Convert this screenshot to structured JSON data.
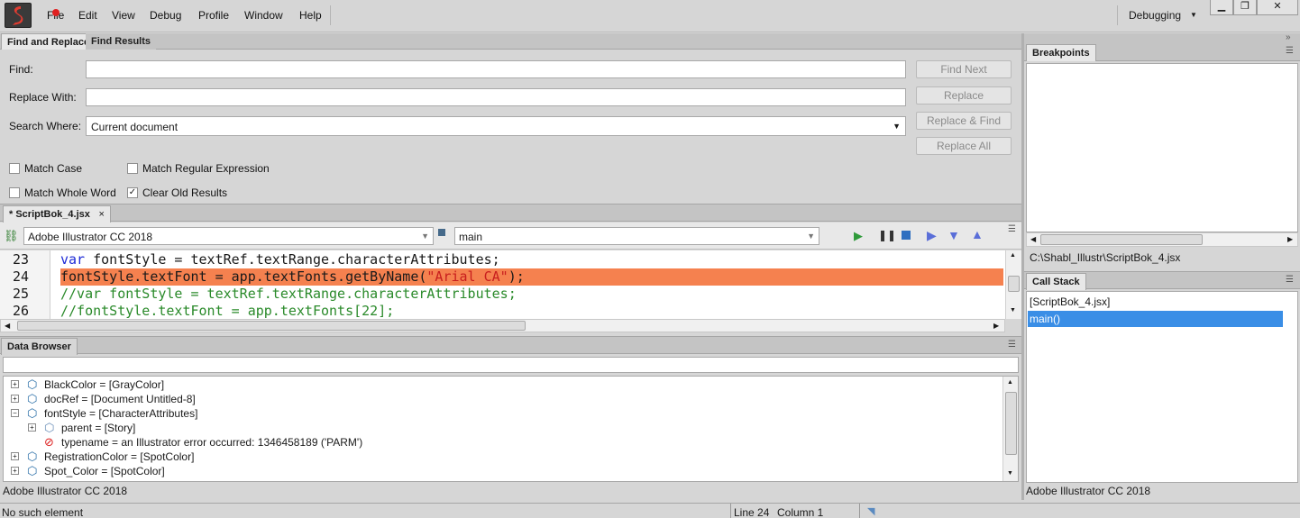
{
  "menubar": {
    "items": [
      "File",
      "Edit",
      "View",
      "Debug",
      "Profile",
      "Window",
      "Help"
    ],
    "mode": "Debugging",
    "window_controls": [
      "minimize-icon",
      "restore-icon",
      "close-icon"
    ]
  },
  "find_panel": {
    "tabs": [
      "Find and Replace",
      "Find Results"
    ],
    "find_label": "Find:",
    "find_value": "",
    "replace_label": "Replace With:",
    "replace_value": "",
    "search_where_label": "Search Where:",
    "search_where_value": "Current document",
    "buttons": [
      "Find Next",
      "Replace",
      "Replace & Find",
      "Replace All"
    ],
    "options": [
      {
        "label": "Match Case",
        "checked": false
      },
      {
        "label": "Match Regular Expression",
        "checked": false
      },
      {
        "label": "Match Whole Word",
        "checked": false
      },
      {
        "label": "Clear Old Results",
        "checked": true
      }
    ]
  },
  "editor": {
    "tab_label": "* ScriptBok_4.jsx",
    "target_app": "Adobe Illustrator CC 2018",
    "function_select": "main",
    "lines": [
      {
        "number": "23",
        "highlighted": false
      },
      {
        "number": "24",
        "highlighted": true
      },
      {
        "number": "25",
        "highlighted": false
      },
      {
        "number": "26",
        "highlighted": false
      }
    ],
    "code": {
      "l23_kw": "var",
      "l23_rest": " fontStyle = textRef.textRange.characterAttributes;",
      "l24_a": "fontStyle.textFont = app.textFonts.getByName(",
      "l24_str": "\"Arial CA\"",
      "l24_b": ");",
      "l25": "//var fontStyle = textRef.textRange.characterAttributes;",
      "l26": "//fontStyle.textFont = app.textFonts[22];"
    },
    "highlight_color": "#f5814f"
  },
  "data_browser": {
    "title": "Data Browser",
    "filter_value": "",
    "items": [
      {
        "text": "BlackColor = [GrayColor]",
        "icon": "object-cube-icon"
      },
      {
        "text": "docRef = [Document Untitled-8]",
        "icon": "object-cube-icon"
      },
      {
        "text": "fontStyle = [CharacterAttributes]",
        "icon": "object-cube-icon"
      },
      {
        "text": "parent = [Story]",
        "icon": "object-cube-icon"
      },
      {
        "text": "typename = an Illustrator error occurred: 1346458189 ('PARM')",
        "icon": "error-circle-icon"
      },
      {
        "text": "RegistrationColor = [SpotColor]",
        "icon": "object-cube-icon"
      },
      {
        "text": "Spot_Color = [SpotColor]",
        "icon": "object-cube-icon"
      }
    ],
    "footer": "Adobe Illustrator CC 2018"
  },
  "breakpoints": {
    "title": "Breakpoints",
    "path": "C:\\Shabl_Illustr\\ScriptBok_4.jsx"
  },
  "call_stack": {
    "title": "Call Stack",
    "items": [
      "[ScriptBok_4.jsx]",
      "main()"
    ],
    "footer": "Adobe Illustrator CC 2018"
  },
  "statusbar": {
    "message": "No such element",
    "line": "Line 24",
    "column": "Column 1"
  }
}
